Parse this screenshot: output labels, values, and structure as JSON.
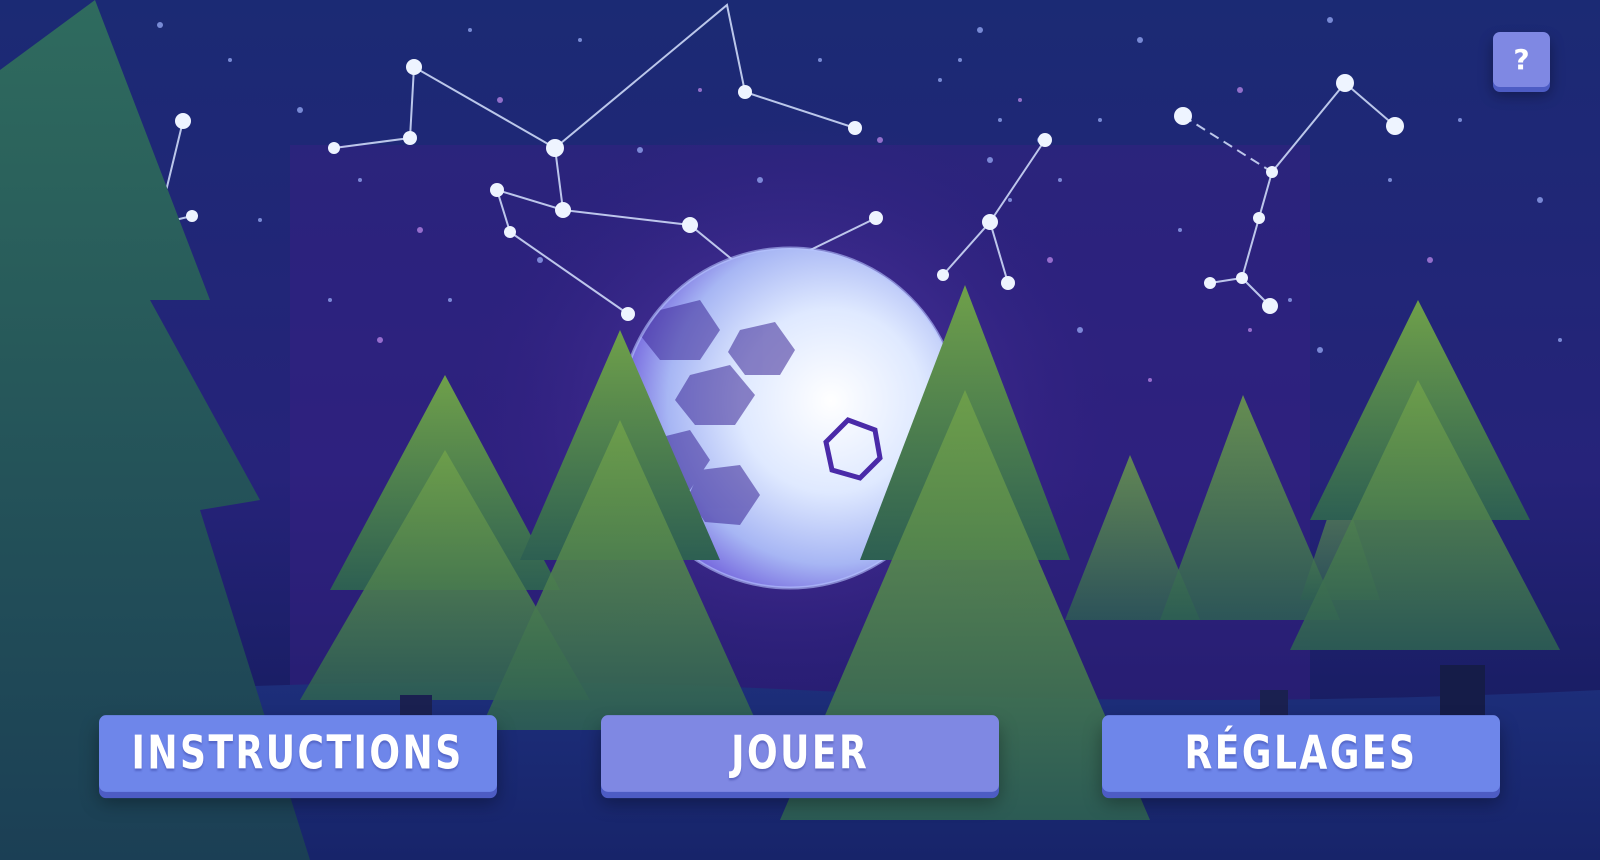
{
  "menu": {
    "instructions_label": "INSTRUCTIONS",
    "play_label": "JOUER",
    "settings_label": "RÉGLAGES"
  },
  "help": {
    "label": "?"
  },
  "scene": {
    "sky_color": "#1e2a7a",
    "orb_color": "#dfe9ff",
    "tree_color": "#3f7a55",
    "button_color": "#6e86ea"
  }
}
